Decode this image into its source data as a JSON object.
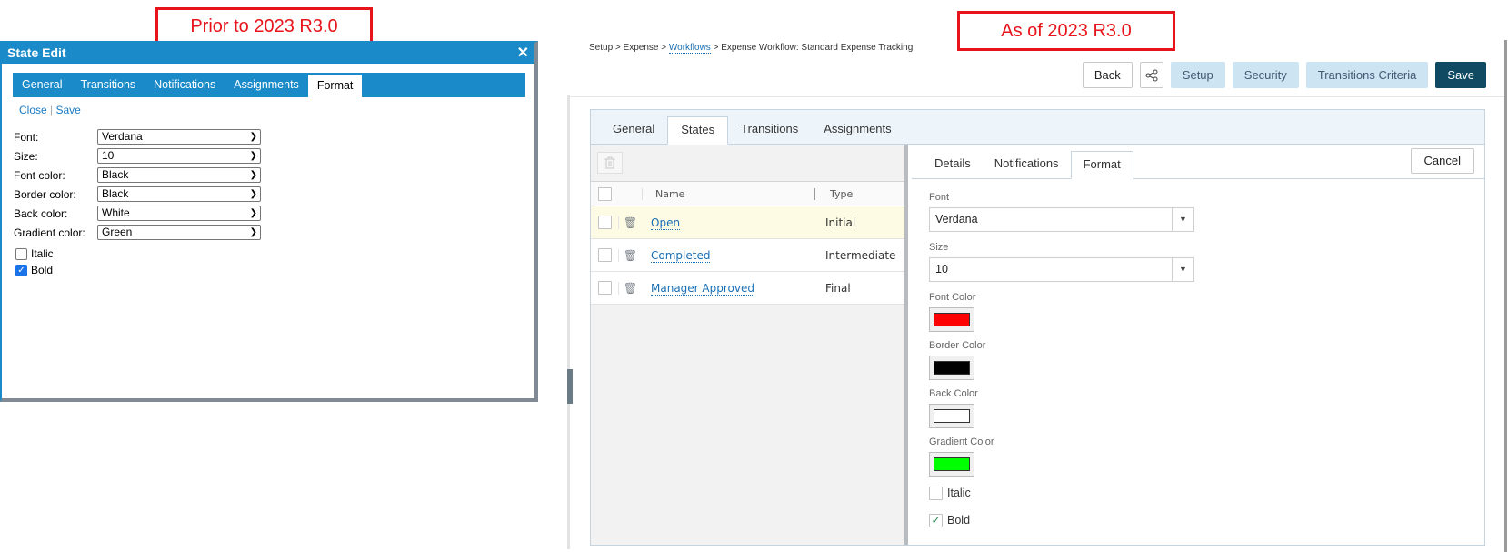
{
  "callouts": {
    "old": "Prior to 2023 R3.0",
    "new": "As of 2023 R3.0"
  },
  "old_dialog": {
    "title": "State Edit",
    "tabs": [
      "General",
      "Transitions",
      "Notifications",
      "Assignments",
      "Format"
    ],
    "active_tab": "Format",
    "links": {
      "close": "Close",
      "separator": "|",
      "save": "Save"
    },
    "fields": [
      {
        "label": "Font:",
        "value": "Verdana"
      },
      {
        "label": "Size:",
        "value": "10"
      },
      {
        "label": "Font color:",
        "value": "Black"
      },
      {
        "label": "Border color:",
        "value": "Black"
      },
      {
        "label": "Back color:",
        "value": "White"
      },
      {
        "label": "Gradient color:",
        "value": "Green"
      }
    ],
    "checkboxes": [
      {
        "label": "Italic",
        "checked": false
      },
      {
        "label": "Bold",
        "checked": true
      }
    ]
  },
  "new_screen": {
    "breadcrumb": {
      "p1": "Setup",
      "p2": "Expense",
      "p3": "Workflows",
      "p4": "Expense Workflow: Standard Expense Tracking",
      "sep": ">"
    },
    "toolbar": {
      "back": "Back",
      "share_icon": "share-icon",
      "setup": "Setup",
      "security": "Security",
      "transitions_criteria": "Transitions Criteria",
      "save": "Save"
    },
    "main_tabs": [
      "General",
      "States",
      "Transitions",
      "Assignments"
    ],
    "active_main_tab": "States",
    "grid": {
      "headers": {
        "name": "Name",
        "type": "Type"
      },
      "rows": [
        {
          "name": "Open",
          "type": "Initial",
          "selected": true
        },
        {
          "name": "Completed",
          "type": "Intermediate",
          "selected": false
        },
        {
          "name": "Manager Approved",
          "type": "Final",
          "selected": false
        }
      ]
    },
    "detail_tabs": [
      "Details",
      "Notifications",
      "Format"
    ],
    "active_detail_tab": "Format",
    "cancel": "Cancel",
    "format": {
      "font_label": "Font",
      "font_value": "Verdana",
      "size_label": "Size",
      "size_value": "10",
      "font_color_label": "Font Color",
      "font_color": "#ff0000",
      "border_color_label": "Border Color",
      "border_color": "#000000",
      "back_color_label": "Back Color",
      "back_color": "#ffffff",
      "gradient_color_label": "Gradient Color",
      "gradient_color": "#00ff00",
      "italic_label": "Italic",
      "italic": false,
      "bold_label": "Bold",
      "bold": true
    }
  }
}
